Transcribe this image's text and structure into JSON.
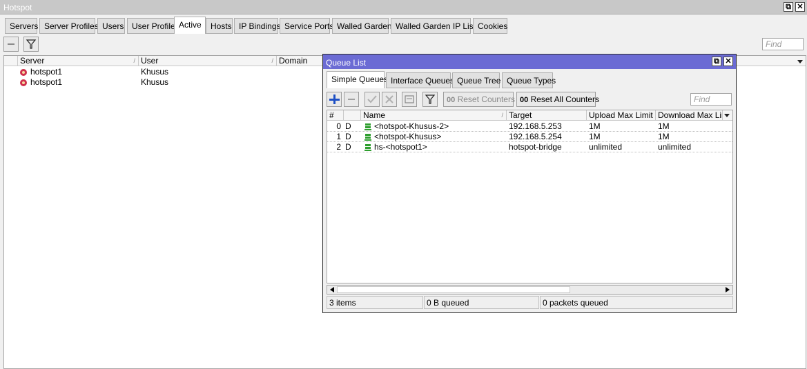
{
  "window": {
    "title": "Hotspot",
    "restore_glyph": "⧉",
    "close_glyph": "✕"
  },
  "tabs": [
    "Servers",
    "Server Profiles",
    "Users",
    "User Profiles",
    "Active",
    "Hosts",
    "IP Bindings",
    "Service Ports",
    "Walled Garden",
    "Walled Garden IP List",
    "Cookies"
  ],
  "active_tab": "Active",
  "find_placeholder": "Find",
  "columns": [
    "Server",
    "User",
    "Domain"
  ],
  "rows": [
    {
      "server": "hotspot1",
      "user": "Khusus"
    },
    {
      "server": "hotspot1",
      "user": "Khusus"
    }
  ],
  "queue_window": {
    "title": "Queue List",
    "tabs": [
      "Simple Queues",
      "Interface Queues",
      "Queue Tree",
      "Queue Types"
    ],
    "active_tab": "Simple Queues",
    "toolbar": {
      "reset_counters": "Reset Counters",
      "reset_all_counters": "Reset All Counters",
      "counter_icon_text": "00"
    },
    "find_placeholder": "Find",
    "columns": [
      "#",
      "Name",
      "Target",
      "Upload Max Limit",
      "Download Max Limi"
    ],
    "rows": [
      {
        "num": "0",
        "flag": "D",
        "name": "<hotspot-Khusus-2>",
        "target": "192.168.5.253",
        "upload": "1M",
        "download": "1M"
      },
      {
        "num": "1",
        "flag": "D",
        "name": "<hotspot-Khusus>",
        "target": "192.168.5.254",
        "upload": "1M",
        "download": "1M"
      },
      {
        "num": "2",
        "flag": "D",
        "name": "hs-<hotspot1>",
        "target": "hotspot-bridge",
        "upload": "unlimited",
        "download": "unlimited"
      }
    ],
    "status": {
      "items": "3 items",
      "queued_bytes": "0 B queued",
      "queued_packets": "0 packets queued"
    }
  },
  "colors": {
    "accent_titlebar": "#6b6bd4",
    "queue_icon": "#2e9e2e",
    "server_icon": "#d0304c",
    "add_icon": "#1d4fc4"
  }
}
